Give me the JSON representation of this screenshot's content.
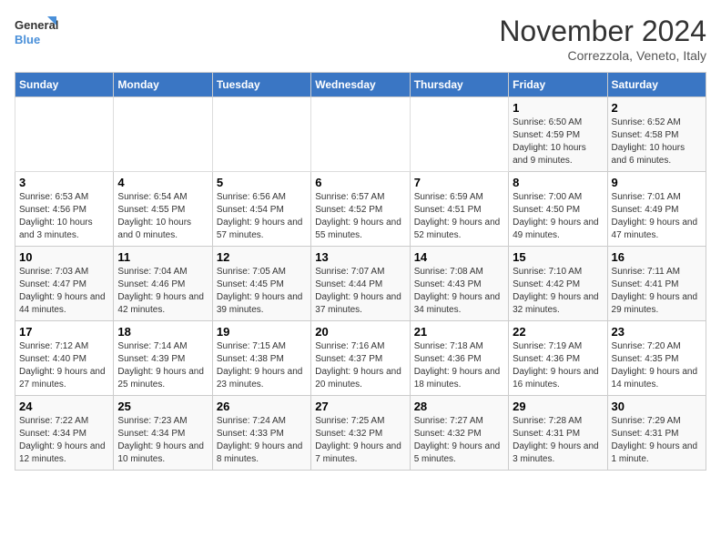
{
  "logo": {
    "line1": "General",
    "line2": "Blue"
  },
  "title": "November 2024",
  "subtitle": "Correzzola, Veneto, Italy",
  "headers": [
    "Sunday",
    "Monday",
    "Tuesday",
    "Wednesday",
    "Thursday",
    "Friday",
    "Saturday"
  ],
  "weeks": [
    [
      {
        "day": "",
        "info": ""
      },
      {
        "day": "",
        "info": ""
      },
      {
        "day": "",
        "info": ""
      },
      {
        "day": "",
        "info": ""
      },
      {
        "day": "",
        "info": ""
      },
      {
        "day": "1",
        "info": "Sunrise: 6:50 AM\nSunset: 4:59 PM\nDaylight: 10 hours and 9 minutes."
      },
      {
        "day": "2",
        "info": "Sunrise: 6:52 AM\nSunset: 4:58 PM\nDaylight: 10 hours and 6 minutes."
      }
    ],
    [
      {
        "day": "3",
        "info": "Sunrise: 6:53 AM\nSunset: 4:56 PM\nDaylight: 10 hours and 3 minutes."
      },
      {
        "day": "4",
        "info": "Sunrise: 6:54 AM\nSunset: 4:55 PM\nDaylight: 10 hours and 0 minutes."
      },
      {
        "day": "5",
        "info": "Sunrise: 6:56 AM\nSunset: 4:54 PM\nDaylight: 9 hours and 57 minutes."
      },
      {
        "day": "6",
        "info": "Sunrise: 6:57 AM\nSunset: 4:52 PM\nDaylight: 9 hours and 55 minutes."
      },
      {
        "day": "7",
        "info": "Sunrise: 6:59 AM\nSunset: 4:51 PM\nDaylight: 9 hours and 52 minutes."
      },
      {
        "day": "8",
        "info": "Sunrise: 7:00 AM\nSunset: 4:50 PM\nDaylight: 9 hours and 49 minutes."
      },
      {
        "day": "9",
        "info": "Sunrise: 7:01 AM\nSunset: 4:49 PM\nDaylight: 9 hours and 47 minutes."
      }
    ],
    [
      {
        "day": "10",
        "info": "Sunrise: 7:03 AM\nSunset: 4:47 PM\nDaylight: 9 hours and 44 minutes."
      },
      {
        "day": "11",
        "info": "Sunrise: 7:04 AM\nSunset: 4:46 PM\nDaylight: 9 hours and 42 minutes."
      },
      {
        "day": "12",
        "info": "Sunrise: 7:05 AM\nSunset: 4:45 PM\nDaylight: 9 hours and 39 minutes."
      },
      {
        "day": "13",
        "info": "Sunrise: 7:07 AM\nSunset: 4:44 PM\nDaylight: 9 hours and 37 minutes."
      },
      {
        "day": "14",
        "info": "Sunrise: 7:08 AM\nSunset: 4:43 PM\nDaylight: 9 hours and 34 minutes."
      },
      {
        "day": "15",
        "info": "Sunrise: 7:10 AM\nSunset: 4:42 PM\nDaylight: 9 hours and 32 minutes."
      },
      {
        "day": "16",
        "info": "Sunrise: 7:11 AM\nSunset: 4:41 PM\nDaylight: 9 hours and 29 minutes."
      }
    ],
    [
      {
        "day": "17",
        "info": "Sunrise: 7:12 AM\nSunset: 4:40 PM\nDaylight: 9 hours and 27 minutes."
      },
      {
        "day": "18",
        "info": "Sunrise: 7:14 AM\nSunset: 4:39 PM\nDaylight: 9 hours and 25 minutes."
      },
      {
        "day": "19",
        "info": "Sunrise: 7:15 AM\nSunset: 4:38 PM\nDaylight: 9 hours and 23 minutes."
      },
      {
        "day": "20",
        "info": "Sunrise: 7:16 AM\nSunset: 4:37 PM\nDaylight: 9 hours and 20 minutes."
      },
      {
        "day": "21",
        "info": "Sunrise: 7:18 AM\nSunset: 4:36 PM\nDaylight: 9 hours and 18 minutes."
      },
      {
        "day": "22",
        "info": "Sunrise: 7:19 AM\nSunset: 4:36 PM\nDaylight: 9 hours and 16 minutes."
      },
      {
        "day": "23",
        "info": "Sunrise: 7:20 AM\nSunset: 4:35 PM\nDaylight: 9 hours and 14 minutes."
      }
    ],
    [
      {
        "day": "24",
        "info": "Sunrise: 7:22 AM\nSunset: 4:34 PM\nDaylight: 9 hours and 12 minutes."
      },
      {
        "day": "25",
        "info": "Sunrise: 7:23 AM\nSunset: 4:34 PM\nDaylight: 9 hours and 10 minutes."
      },
      {
        "day": "26",
        "info": "Sunrise: 7:24 AM\nSunset: 4:33 PM\nDaylight: 9 hours and 8 minutes."
      },
      {
        "day": "27",
        "info": "Sunrise: 7:25 AM\nSunset: 4:32 PM\nDaylight: 9 hours and 7 minutes."
      },
      {
        "day": "28",
        "info": "Sunrise: 7:27 AM\nSunset: 4:32 PM\nDaylight: 9 hours and 5 minutes."
      },
      {
        "day": "29",
        "info": "Sunrise: 7:28 AM\nSunset: 4:31 PM\nDaylight: 9 hours and 3 minutes."
      },
      {
        "day": "30",
        "info": "Sunrise: 7:29 AM\nSunset: 4:31 PM\nDaylight: 9 hours and 1 minute."
      }
    ]
  ]
}
